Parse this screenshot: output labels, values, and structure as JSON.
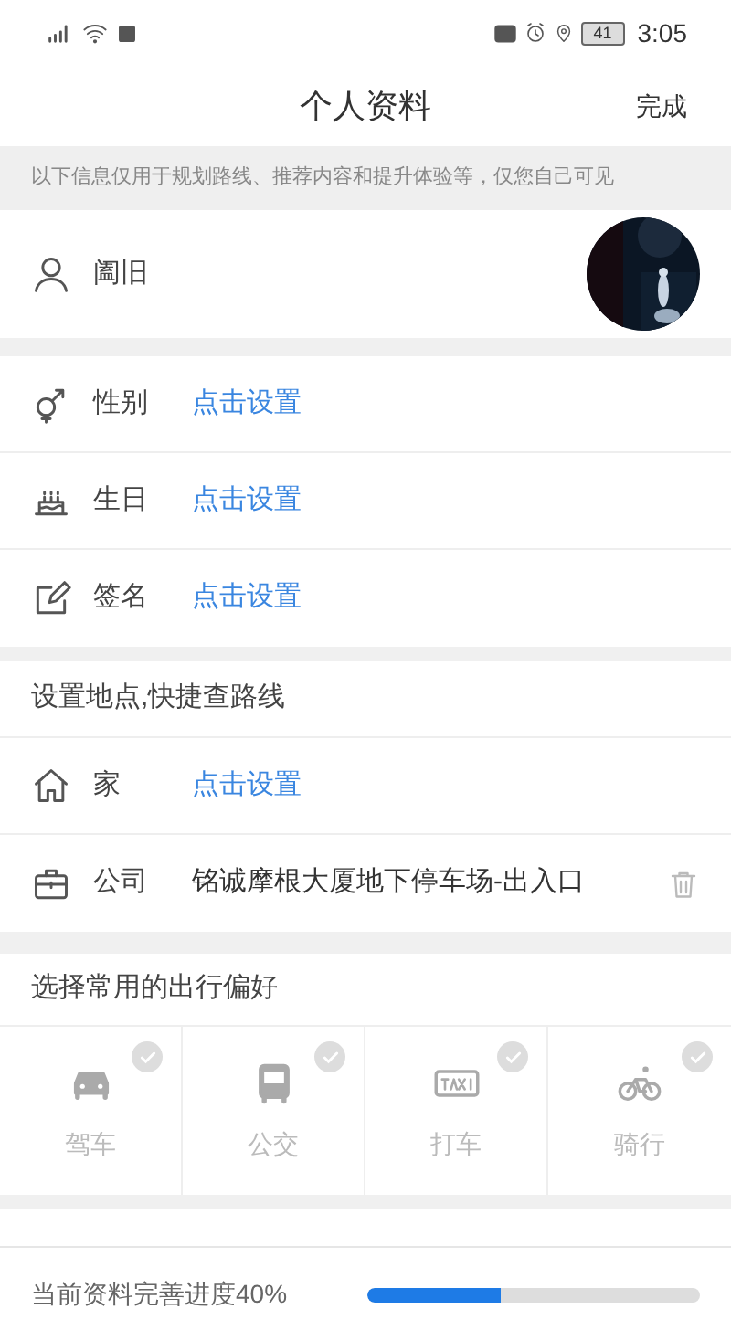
{
  "status_bar": {
    "time": "3:05",
    "battery": "41"
  },
  "header": {
    "title": "个人资料",
    "action": "完成"
  },
  "notice": "以下信息仅用于规划路线、推荐内容和提升体验等，仅您自己可见",
  "profile": {
    "nickname": "阖旧"
  },
  "fields": [
    {
      "kind": "gender",
      "label": "性别",
      "value": "点击设置",
      "set": false
    },
    {
      "kind": "birthday",
      "label": "生日",
      "value": "点击设置",
      "set": false
    },
    {
      "kind": "signature",
      "label": "签名",
      "value": "点击设置",
      "set": false
    }
  ],
  "places": {
    "title": "设置地点,快捷查路线",
    "items": [
      {
        "kind": "home",
        "label": "家",
        "value": "点击设置",
        "set": false
      },
      {
        "kind": "work",
        "label": "公司",
        "value": "铭诚摩根大厦地下停车场-出入口",
        "set": true
      }
    ]
  },
  "travel": {
    "title": "选择常用的出行偏好",
    "modes": [
      {
        "kind": "car",
        "label": "驾车",
        "selected": false
      },
      {
        "kind": "bus",
        "label": "公交",
        "selected": false
      },
      {
        "kind": "taxi",
        "label": "打车",
        "selected": false
      },
      {
        "kind": "bike",
        "label": "骑行",
        "selected": false
      }
    ]
  },
  "footer": {
    "label": "当前资料完善进度40%",
    "level": 0.4
  }
}
